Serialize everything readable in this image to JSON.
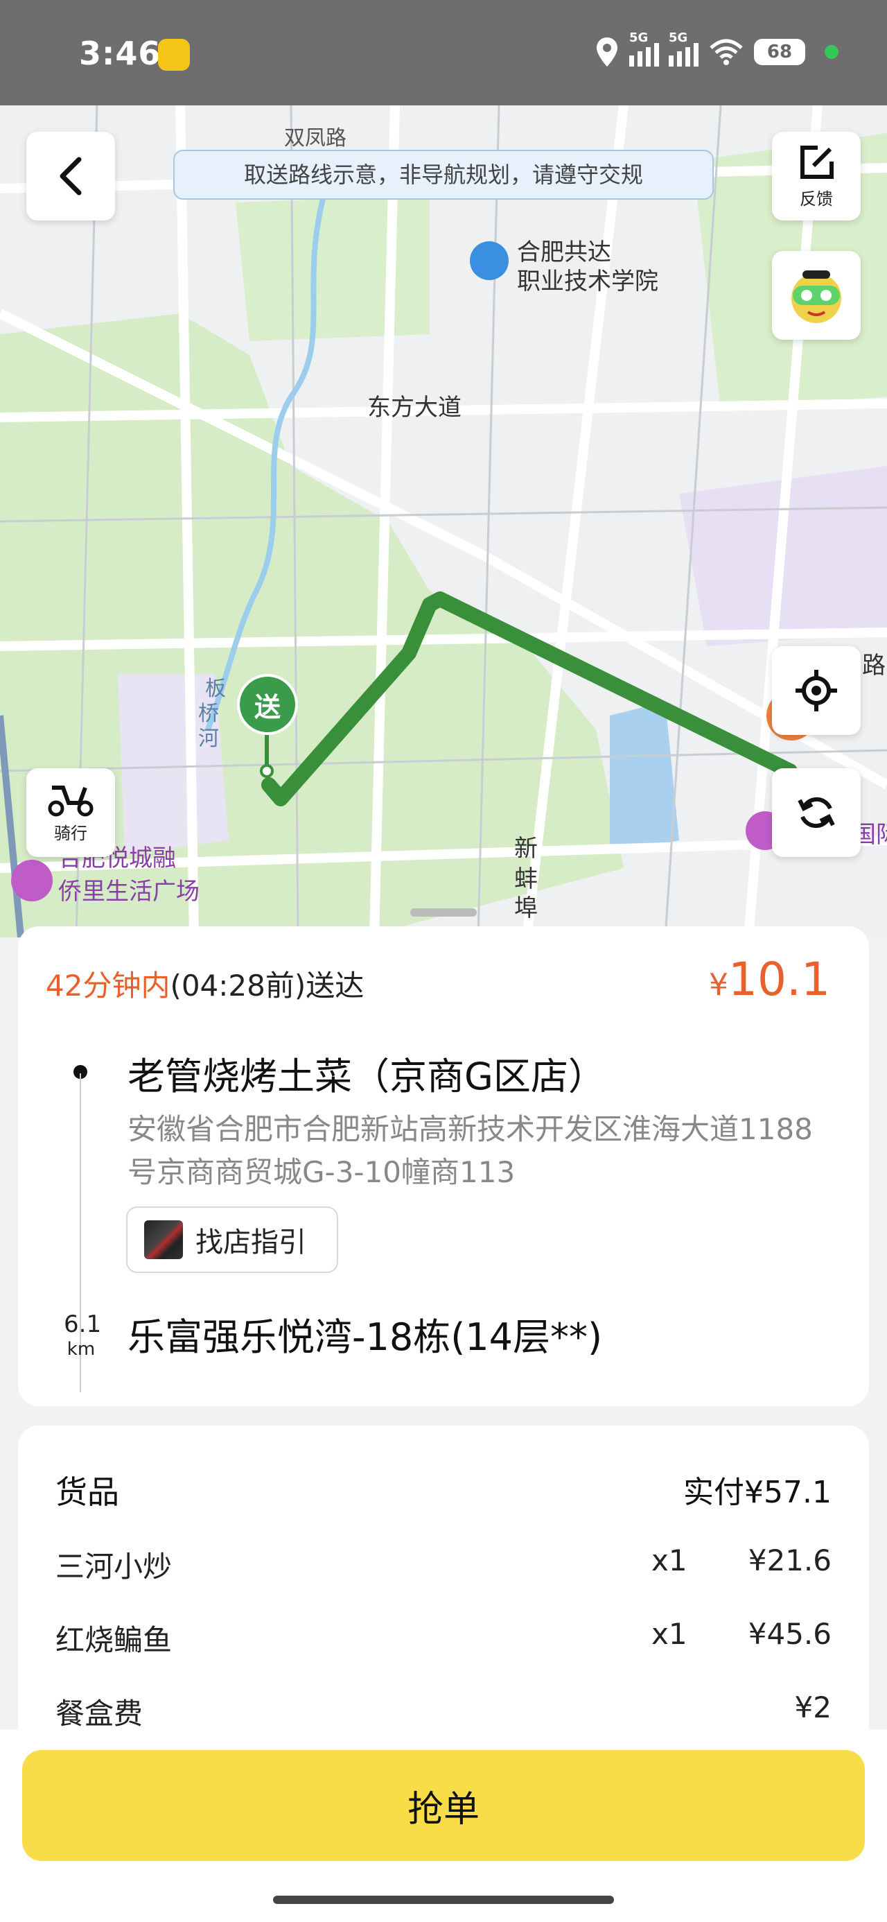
{
  "status_bar": {
    "time": "3:46",
    "network1": "5G",
    "network2": "5G",
    "battery": "68"
  },
  "map": {
    "notice": "取送路线示意，非导航规划，请遵守交规",
    "feedback_label": "反馈",
    "ride_label": "骑行",
    "delivery_marker": "送",
    "labels": {
      "road_top": "双凤路",
      "school_line1": "合肥共达",
      "school_line2": "职业技术学院",
      "avenue": "东方大道",
      "river_1": "板",
      "river_2": "桥",
      "river_3": "河",
      "mall_line1": "合肥悦城融",
      "mall_line2": "侨里生活广场",
      "xinbeng_1": "新",
      "xinbeng_2": "蚌",
      "xinbeng_3": "埠",
      "right_1": "国际",
      "right_2": "路"
    }
  },
  "order": {
    "eta_time": "42分钟内",
    "eta_rest": "(04:28前)送达",
    "price_symbol": "¥",
    "price": "10.1",
    "shop_name": "老管烧烤土菜（京商G区店）",
    "shop_address": "安徽省合肥市合肥新站高新技术开发区淮海大道1188号京商商贸城G-3-10幢商113",
    "guide_label": "找店指引",
    "distance_value": "6.1",
    "distance_unit": "km",
    "destination": "乐富强乐悦湾-18栋(14层**)"
  },
  "goods": {
    "header": "货品",
    "paid": "实付¥57.1",
    "items": [
      {
        "name": "三河小炒",
        "qty": "x1",
        "price": "¥21.6"
      },
      {
        "name": "红烧鳊鱼",
        "qty": "x1",
        "price": "¥45.6"
      },
      {
        "name": "餐盒费",
        "qty": "",
        "price": "¥2"
      }
    ]
  },
  "action": {
    "grab_label": "抢单"
  },
  "colors": {
    "accent_orange": "#e8612c",
    "route_green": "#3a8f3a",
    "button_yellow": "#f9dd48"
  }
}
